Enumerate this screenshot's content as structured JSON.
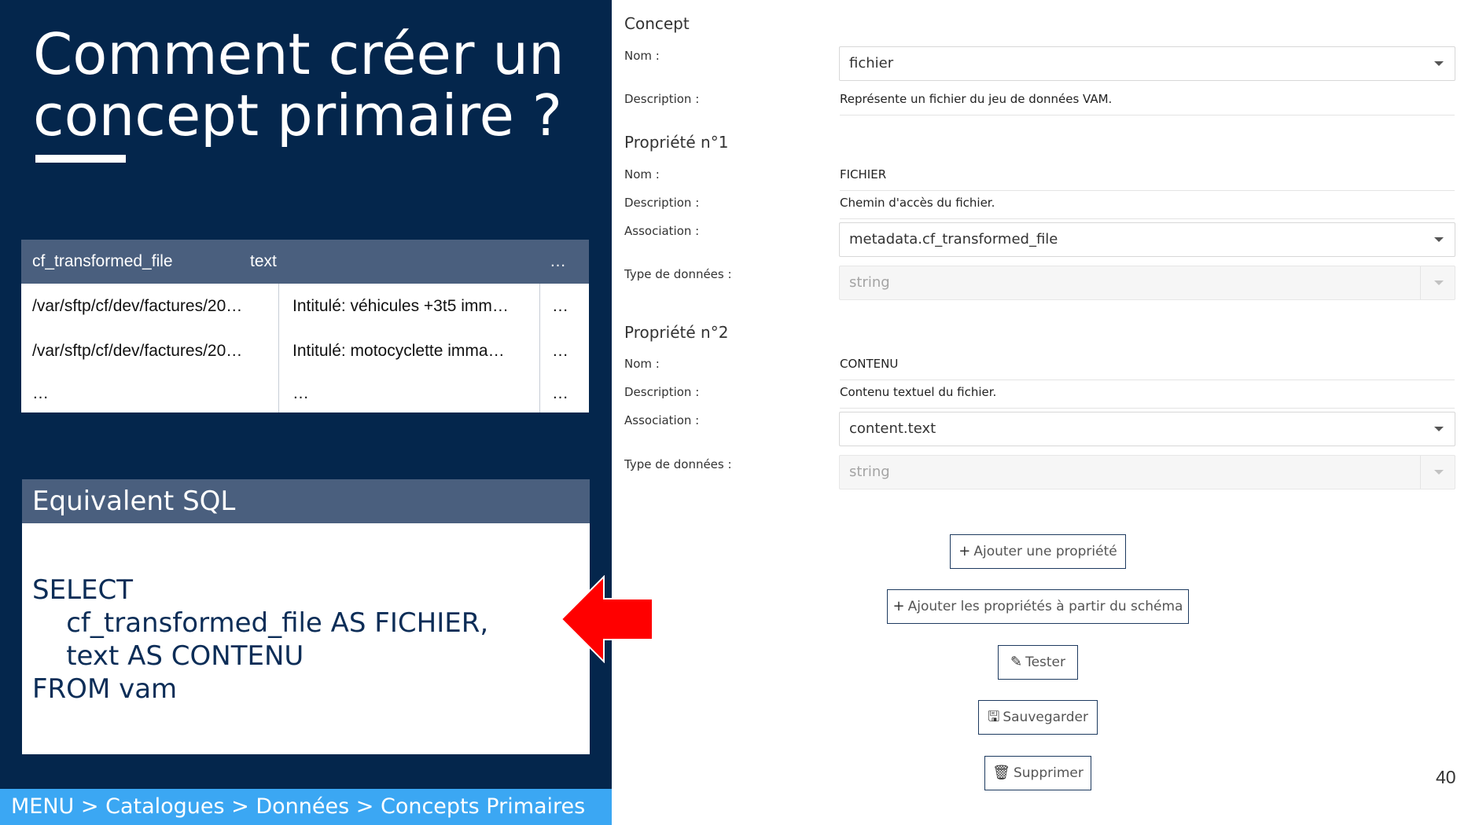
{
  "slide": {
    "title_line1": "Comment créer un",
    "title_line2": "concept primaire ?",
    "table": {
      "headers": [
        "cf_transformed_file",
        "text",
        "…"
      ],
      "rows": [
        [
          "/var/sftp/cf/dev/factures/20…",
          "Intitulé:  véhicules +3t5 imm…",
          "…"
        ],
        [
          "/var/sftp/cf/dev/factures/20…",
          "Intitulé:  motocyclette imma…",
          "…"
        ],
        [
          "…",
          "…",
          "…"
        ]
      ]
    },
    "sql": {
      "header": "Equivalent SQL",
      "line1": "SELECT",
      "line2": "    cf_transformed_file AS FICHIER,",
      "line3": "    text AS CONTENU",
      "line4": "FROM vam"
    },
    "breadcrumb": "MENU > Catalogues > Données > Concepts Primaires",
    "arrow_color": "#ff0000"
  },
  "form": {
    "concept": {
      "title": "Concept",
      "name_label": "Nom :",
      "name_value": "fichier",
      "description_label": "Description :",
      "description_value": "Représente un fichier du jeu de données VAM."
    },
    "properties": [
      {
        "title": "Propriété n°1",
        "name_label": "Nom :",
        "name_value": "FICHIER",
        "description_label": "Description :",
        "description_value": "Chemin d'accès du fichier.",
        "association_label": "Association :",
        "association_value": "metadata.cf_transformed_file",
        "type_label": "Type de données :",
        "type_value": "string"
      },
      {
        "title": "Propriété n°2",
        "name_label": "Nom :",
        "name_value": "CONTENU",
        "description_label": "Description :",
        "description_value": "Contenu textuel du fichier.",
        "association_label": "Association :",
        "association_value": "content.text",
        "type_label": "Type de données :",
        "type_value": "string"
      }
    ],
    "buttons": {
      "add_property": "Ajouter une propriété",
      "add_from_schema": "Ajouter les propriétés à partir du schéma",
      "test": "Tester",
      "save": "Sauvegarder",
      "delete": "Supprimer"
    },
    "icons": {
      "add": "plus-icon",
      "test": "pencil-icon",
      "save": "floppy-disk-icon",
      "delete": "trash-icon"
    }
  },
  "page_number": "40",
  "colors": {
    "navy": "#04264c",
    "table_header": "#4a5f7e",
    "breadcrumb_bar": "#3ba7f3",
    "button_border": "#1d3a5f"
  }
}
